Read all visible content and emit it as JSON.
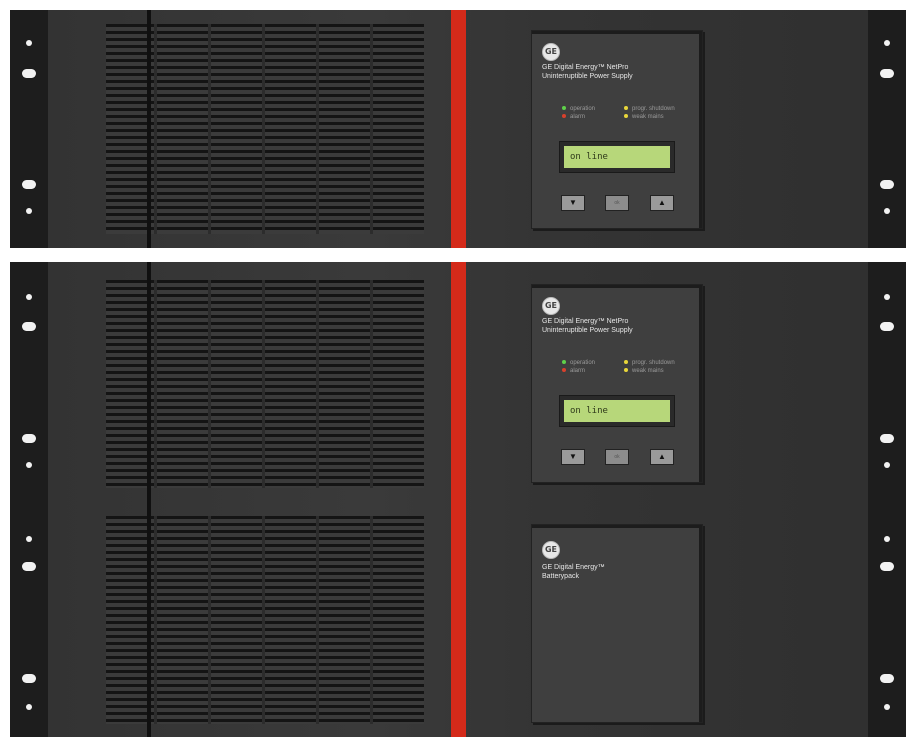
{
  "units": [
    {
      "brand_line1": "GE Digital Energy™ NetPro",
      "brand_line2": "Uninterruptible Power Supply",
      "status": {
        "operation": "operation",
        "alarm": "alarm",
        "prog_shutdown": "progr. shutdown",
        "weak_mains": "weak mains"
      },
      "lcd": "on line",
      "buttons": {
        "down": "▼",
        "ok": "ok",
        "up": "▲"
      }
    },
    {
      "brand_line1": "GE Digital Energy™ NetPro",
      "brand_line2": "Uninterruptible Power Supply",
      "status": {
        "operation": "operation",
        "alarm": "alarm",
        "prog_shutdown": "progr. shutdown",
        "weak_mains": "weak mains"
      },
      "lcd": "on line",
      "buttons": {
        "down": "▼",
        "ok": "ok",
        "up": "▲"
      }
    },
    {
      "brand_line1": "GE Digital Energy™",
      "brand_line2": "Batterypack"
    }
  ],
  "logo": "GE",
  "colors": {
    "accent_stripe": "#d42a1a",
    "lcd": "#b7d77a",
    "led_operation": "#5fd14a",
    "led_alarm": "#d8402c",
    "led_warning": "#e8d63a"
  }
}
